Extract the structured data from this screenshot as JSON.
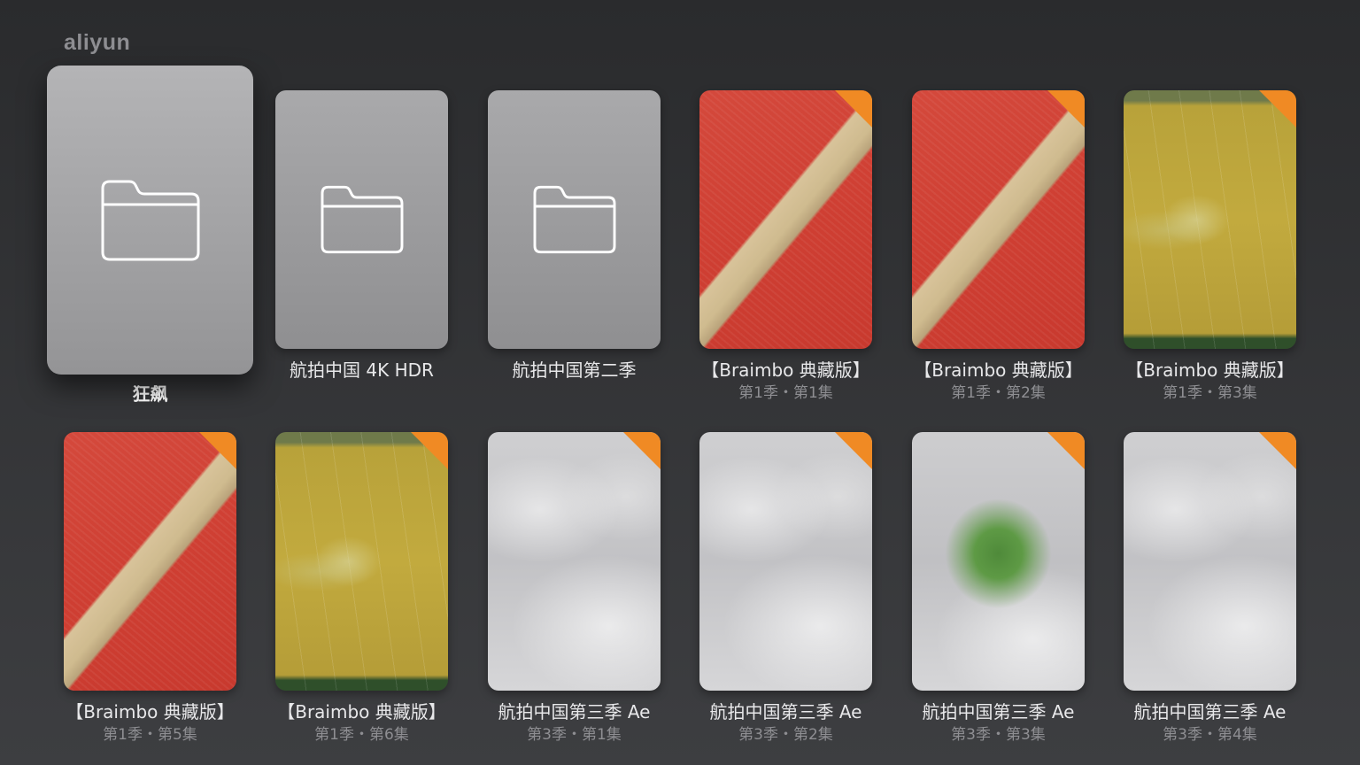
{
  "header": {
    "title": "aliyun"
  },
  "colors": {
    "badge": "#f08a24",
    "background": "#2f3032"
  },
  "items": [
    {
      "kind": "folder",
      "focused": true,
      "icon": "folder-icon",
      "title": "狂飙",
      "subtitle": ""
    },
    {
      "kind": "folder",
      "focused": false,
      "icon": "folder-icon",
      "title": "航拍中国 4K HDR",
      "subtitle": ""
    },
    {
      "kind": "folder",
      "focused": false,
      "icon": "folder-icon",
      "title": "航拍中国第二季",
      "subtitle": ""
    },
    {
      "kind": "video",
      "thumb": "red",
      "title": "【Braimbo 典藏版】",
      "subtitle": "第1季・第1集"
    },
    {
      "kind": "video",
      "thumb": "red",
      "title": "【Braimbo 典藏版】",
      "subtitle": "第1季・第2集"
    },
    {
      "kind": "video",
      "thumb": "gold",
      "title": "【Braimbo 典藏版】",
      "subtitle": "第1季・第3集"
    },
    {
      "kind": "video",
      "thumb": "red",
      "title": "【Braimbo 典藏版】",
      "subtitle": "第1季・第5集"
    },
    {
      "kind": "video",
      "thumb": "gold",
      "title": "【Braimbo 典藏版】",
      "subtitle": "第1季・第6集"
    },
    {
      "kind": "video",
      "thumb": "cloud",
      "title": "航拍中国第三季 Ae",
      "subtitle": "第3季・第1集"
    },
    {
      "kind": "video",
      "thumb": "cloud",
      "title": "航拍中国第三季 Ae",
      "subtitle": "第3季・第2集"
    },
    {
      "kind": "video",
      "thumb": "cloud-green",
      "title": "航拍中国第三季 Ae",
      "subtitle": "第3季・第3集"
    },
    {
      "kind": "video",
      "thumb": "cloud",
      "title": "航拍中国第三季 Ae",
      "subtitle": "第3季・第4集"
    }
  ]
}
